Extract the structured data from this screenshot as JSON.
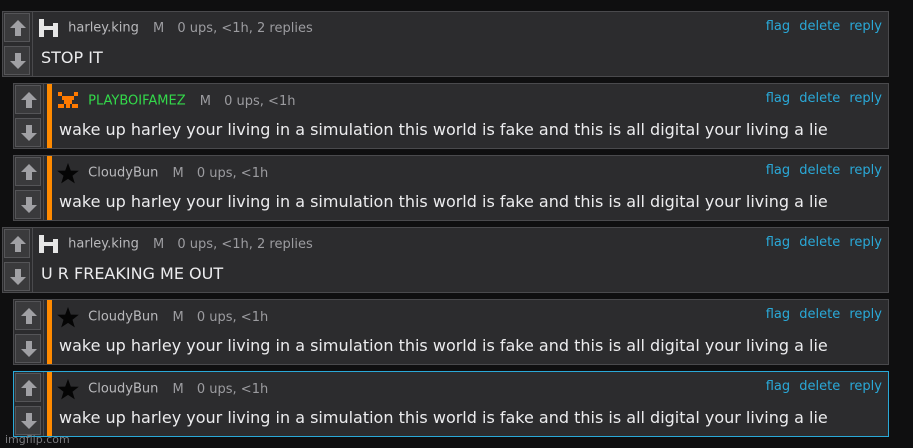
{
  "actions": {
    "flag": "flag",
    "delete": "delete",
    "reply": "reply"
  },
  "comments": [
    {
      "username": "harley.king",
      "gender": "M",
      "meta": "0 ups, <1h, 2 replies",
      "text": "STOP IT"
    },
    {
      "username": "PLAYBOIFAMEZ",
      "gender": "M",
      "meta": "0 ups, <1h",
      "text": "wake up harley your living in a simulation this world is fake and this is all digital your living a lie"
    },
    {
      "username": "CloudyBun",
      "gender": "M",
      "meta": "0 ups, <1h",
      "text": "wake up harley your living in a simulation this world is fake and this is all digital your living a lie"
    },
    {
      "username": "harley.king",
      "gender": "M",
      "meta": "0 ups, <1h, 2 replies",
      "text": "U R FREAKING ME OUT"
    },
    {
      "username": "CloudyBun",
      "gender": "M",
      "meta": "0 ups, <1h",
      "text": "wake up harley your living in a simulation this world is fake and this is all digital your living a lie"
    },
    {
      "username": "CloudyBun",
      "gender": "M",
      "meta": "0 ups, <1h",
      "text": "wake up harley your living in a simulation this world is fake and this is all digital your living a lie"
    }
  ],
  "watermark": "imgflip.com",
  "colors": {
    "link": "#2aa9d8",
    "reply_bar": "#ff8a00",
    "highlight_border": "#2aa9d8",
    "green_username": "#33d94a"
  }
}
